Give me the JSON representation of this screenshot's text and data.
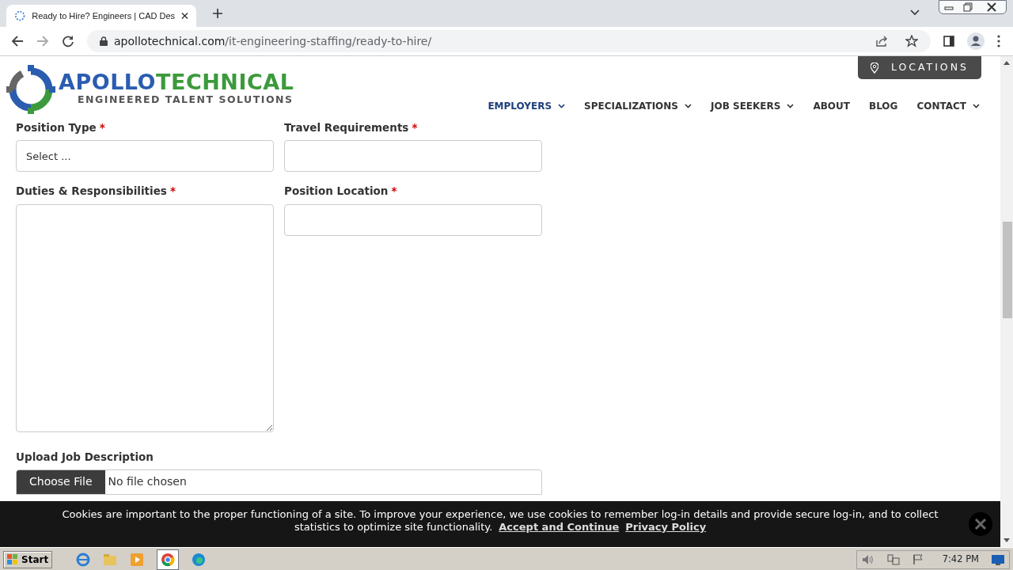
{
  "browser": {
    "tab_title": "Ready to Hire? Engineers | CAD Des",
    "url_domain": "apollotechnical.com",
    "url_path": "/it-engineering-staffing/ready-to-hire/"
  },
  "header": {
    "logo_words": [
      "APOLLO",
      "TECHNICAL"
    ],
    "tagline": "ENGINEERED TALENT SOLUTIONS",
    "locations_button": "LOCATIONS",
    "nav": [
      {
        "label": "EMPLOYERS",
        "dropdown": true,
        "selected": true
      },
      {
        "label": "SPECIALIZATIONS",
        "dropdown": true,
        "selected": false
      },
      {
        "label": "JOB SEEKERS",
        "dropdown": true,
        "selected": false
      },
      {
        "label": "ABOUT",
        "dropdown": false,
        "selected": false
      },
      {
        "label": "BLOG",
        "dropdown": false,
        "selected": false
      },
      {
        "label": "CONTACT",
        "dropdown": true,
        "selected": false
      }
    ]
  },
  "form": {
    "fields": [
      {
        "kind": "select",
        "label": "Position Type",
        "required_mark": "*",
        "value": "Select ..."
      },
      {
        "kind": "text",
        "label": "Travel Requirements",
        "required_mark": "*"
      },
      {
        "kind": "textarea",
        "label": "Duties & Responsibilities",
        "required_mark": "*"
      },
      {
        "kind": "text",
        "label": "Position Location",
        "required_mark": "*"
      },
      {
        "kind": "file",
        "label": "Upload Job Description",
        "button": "Choose File",
        "status": "No file chosen"
      }
    ]
  },
  "cookie_banner": {
    "text": "Cookies are important to the proper functioning of a site. To improve your experience, we use cookies to remember log-in details and provide secure log-in, and to collect statistics to optimize site functionality.",
    "accept_link": "Accept and Continue",
    "privacy_link": "Privacy Policy"
  },
  "taskbar": {
    "start": "Start",
    "clock": "7:42 PM"
  }
}
